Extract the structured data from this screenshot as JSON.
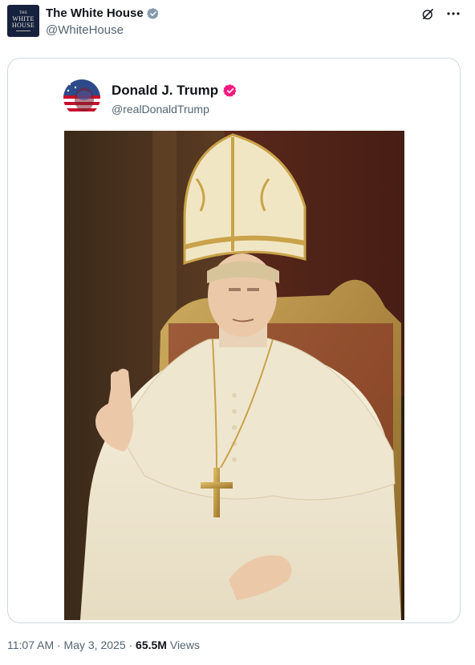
{
  "tweet": {
    "author_name": "The White House",
    "author_handle": "@WhiteHouse",
    "avatar_lines": [
      "THE",
      "WHITE",
      "HOUSE"
    ],
    "verified_color": "#829aab",
    "quoted": {
      "name": "Donald J. Trump",
      "handle": "@realDonaldTrump",
      "verified_color": "#f91880"
    },
    "timestamp": "11:07 AM · May 3, 2025 · ",
    "views_count": "65.5M",
    "views_label": " Views"
  },
  "colors": {
    "card_border": "#cfd9de",
    "secondary_text": "#536471",
    "robe": "#f2ead5",
    "gold": "#c9a24a"
  },
  "icons": [
    "verified-icon",
    "grok-icon",
    "more-icon"
  ]
}
